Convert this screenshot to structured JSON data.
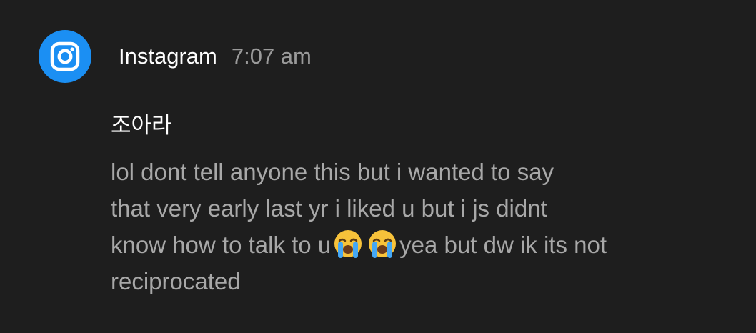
{
  "notification": {
    "app_icon": "instagram-icon",
    "app_name": "Instagram",
    "time": "7:07 am",
    "sender": "조아라",
    "message_lines": [
      "lol dont tell anyone this but i wanted to say",
      "that very early last yr i liked u but i js didnt",
      "know how to talk to u",
      "yea but dw ik its not",
      "reciprocated"
    ],
    "emojis": [
      "loudly-crying-face-emoji",
      "loudly-crying-face-emoji"
    ]
  },
  "colors": {
    "background": "#1e1e1e",
    "app_icon_bg": "#1b8ff3",
    "title_text": "#ffffff",
    "time_text": "#9a9a9a",
    "message_text": "#a8a8a8"
  }
}
